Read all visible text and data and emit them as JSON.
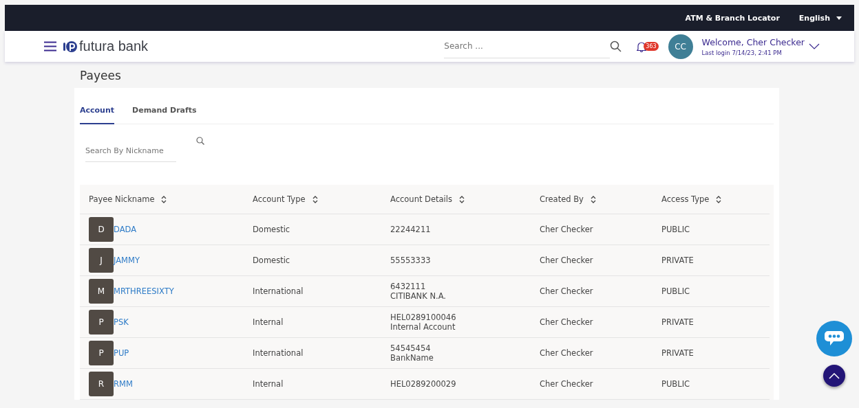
{
  "topbar": {
    "links": [
      "ATM & Branch Locator"
    ],
    "language": "English"
  },
  "header": {
    "brand": "futura bank",
    "search": {
      "placeholder": "Search ..."
    },
    "notifications": "363",
    "avatar": "CC",
    "welcome": "Welcome, Cher Checker",
    "last_login": "Last login 7/14/23, 2:41 PM"
  },
  "page_title": "Payees",
  "tabs": [
    {
      "label": "Account",
      "selected": true
    },
    {
      "label": "Demand Drafts",
      "selected": false
    }
  ],
  "nickname_search": {
    "placeholder": "Search By Nickname"
  },
  "table": {
    "columns": [
      "Payee Nickname",
      "Account Type",
      "Account Details",
      "Created By",
      "Access Type"
    ],
    "rows": [
      {
        "initial": "D",
        "nickname": "DADA",
        "account_type": "Domestic",
        "details": [
          "22244211"
        ],
        "created_by": "Cher Checker",
        "access": "PUBLIC"
      },
      {
        "initial": "J",
        "nickname": "JAMMY",
        "account_type": "Domestic",
        "details": [
          "55553333"
        ],
        "created_by": "Cher Checker",
        "access": "PRIVATE"
      },
      {
        "initial": "M",
        "nickname": "MRTHREESIXTY",
        "account_type": "International",
        "details": [
          "6432111",
          "CITIBANK N.A."
        ],
        "created_by": "Cher Checker",
        "access": "PUBLIC"
      },
      {
        "initial": "P",
        "nickname": "PSK",
        "account_type": "Internal",
        "details": [
          "HEL0289100046",
          "Internal Account"
        ],
        "created_by": "Cher Checker",
        "access": "PRIVATE"
      },
      {
        "initial": "P",
        "nickname": "PUP",
        "account_type": "International",
        "details": [
          "54545454",
          "BankName"
        ],
        "created_by": "Cher Checker",
        "access": "PRIVATE"
      },
      {
        "initial": "R",
        "nickname": "RMM",
        "account_type": "Internal",
        "details": [
          "HEL0289200029"
        ],
        "created_by": "Cher Checker",
        "access": "PUBLIC"
      }
    ]
  }
}
